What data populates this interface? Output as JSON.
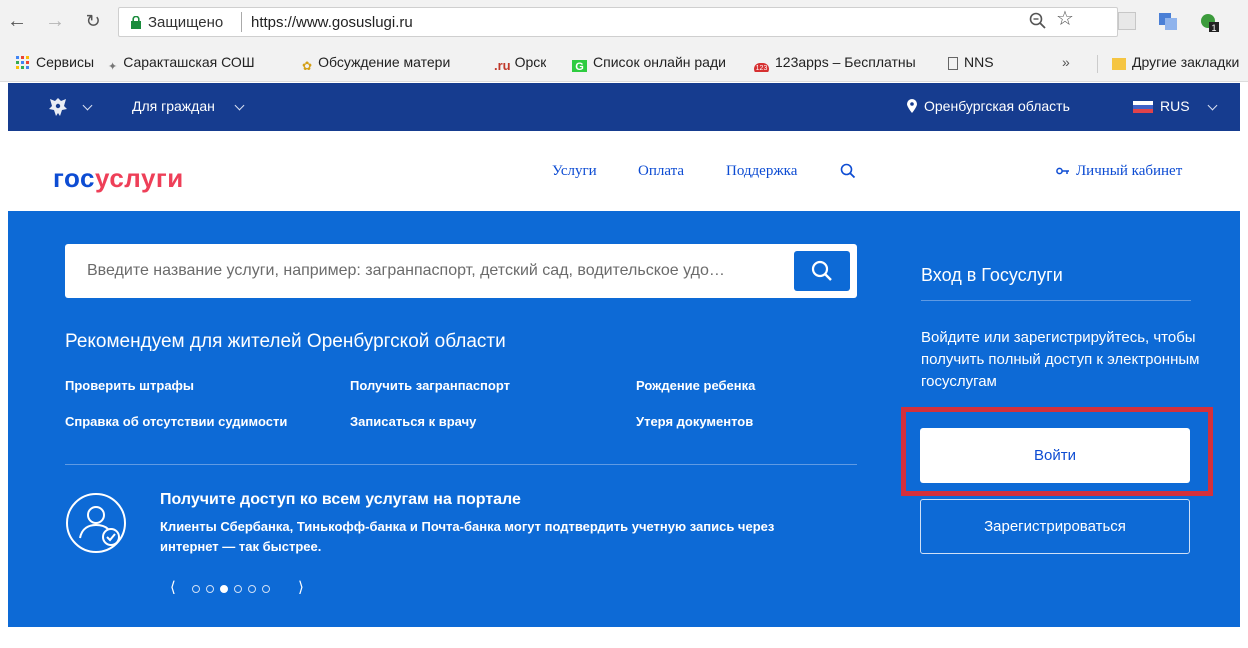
{
  "browser": {
    "secure_label": "Защищено",
    "url": "https://www.gosuslugi.ru"
  },
  "bookmarks": [
    {
      "label": "Сервисы",
      "icon": "apps-grid-icon"
    },
    {
      "label": "Саракташская СОШ",
      "icon": "school-icon"
    },
    {
      "label": "Обсуждение матери",
      "icon": "discussion-icon"
    },
    {
      "label": "Орск",
      "icon": "ru-icon",
      "prefix": ".ru"
    },
    {
      "label": "Список онлайн ради",
      "icon": "radio-icon"
    },
    {
      "label": "123apps – Бесплатны",
      "icon": "apps123-icon"
    },
    {
      "label": "NNS",
      "icon": "page-icon"
    },
    {
      "label": "Другие закладки",
      "icon": "folder-icon"
    }
  ],
  "topbar": {
    "citizens": "Для граждан",
    "region": "Оренбургская область",
    "language": "RUS"
  },
  "header": {
    "logo_part1": "гос",
    "logo_part2": "услуги",
    "menu": [
      "Услуги",
      "Оплата",
      "Поддержка"
    ],
    "cabinet": "Личный кабинет"
  },
  "hero": {
    "search_placeholder": "Введите название услуги, например: загранпаспорт, детский сад, водительское удо…",
    "rec_title": "Рекомендуем для жителей Оренбургской области",
    "links": [
      "Проверить штрафы",
      "Получить загранпаспорт",
      "Рождение ребенка",
      "Справка об отсутствии судимости",
      "Записаться к врачу",
      "Утеря документов"
    ],
    "promo_title": "Получите доступ ко всем услугам на портале",
    "promo_text": "Клиенты Сбербанка, Тинькофф-банка и Почта-банка могут подтвердить учетную запись через интернет — так быстрее.",
    "carousel_active": 3,
    "carousel_total": 6
  },
  "login": {
    "title": "Вход в Госуслуги",
    "desc": "Войдите или зарегистрируйтесь, чтобы получить полный доступ к электронным госуслугам",
    "login_button": "Войти",
    "register_button": "Зарегистрироваться"
  },
  "colors": {
    "accent_blue": "#0d6ad6",
    "topbar_blue": "#163c8f",
    "logo_blue": "#0d4cd3",
    "logo_red": "#ee3f58",
    "highlight_red": "#d4303b"
  }
}
